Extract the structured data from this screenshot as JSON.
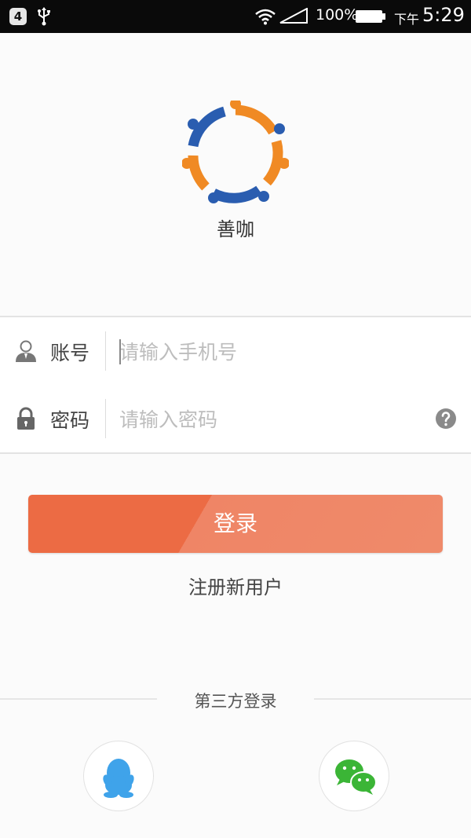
{
  "status_bar": {
    "notification_count": "4",
    "battery_percent": "100%",
    "ampm": "下午",
    "time": "5:29",
    "icons": [
      "usb-icon",
      "wifi-icon",
      "signal-icon",
      "battery-icon"
    ]
  },
  "app": {
    "name": "善咖",
    "logo_colors": {
      "blue": "#2a5db0",
      "orange": "#f08a24"
    }
  },
  "form": {
    "account": {
      "label": "账号",
      "placeholder": "请输入手机号",
      "value": "",
      "icon": "user-icon"
    },
    "password": {
      "label": "密码",
      "placeholder": "请输入密码",
      "value": "",
      "icon": "lock-icon",
      "help_icon": "question-icon"
    }
  },
  "login_button": {
    "label": "登录",
    "color": "#ec6b44"
  },
  "register_link": {
    "label": "注册新用户"
  },
  "third_party": {
    "title": "第三方登录",
    "providers": [
      {
        "name": "QQ",
        "icon": "qq-icon",
        "color": "#3fa3ea"
      },
      {
        "name": "WeChat",
        "icon": "wechat-icon",
        "color": "#3bb536"
      }
    ]
  }
}
